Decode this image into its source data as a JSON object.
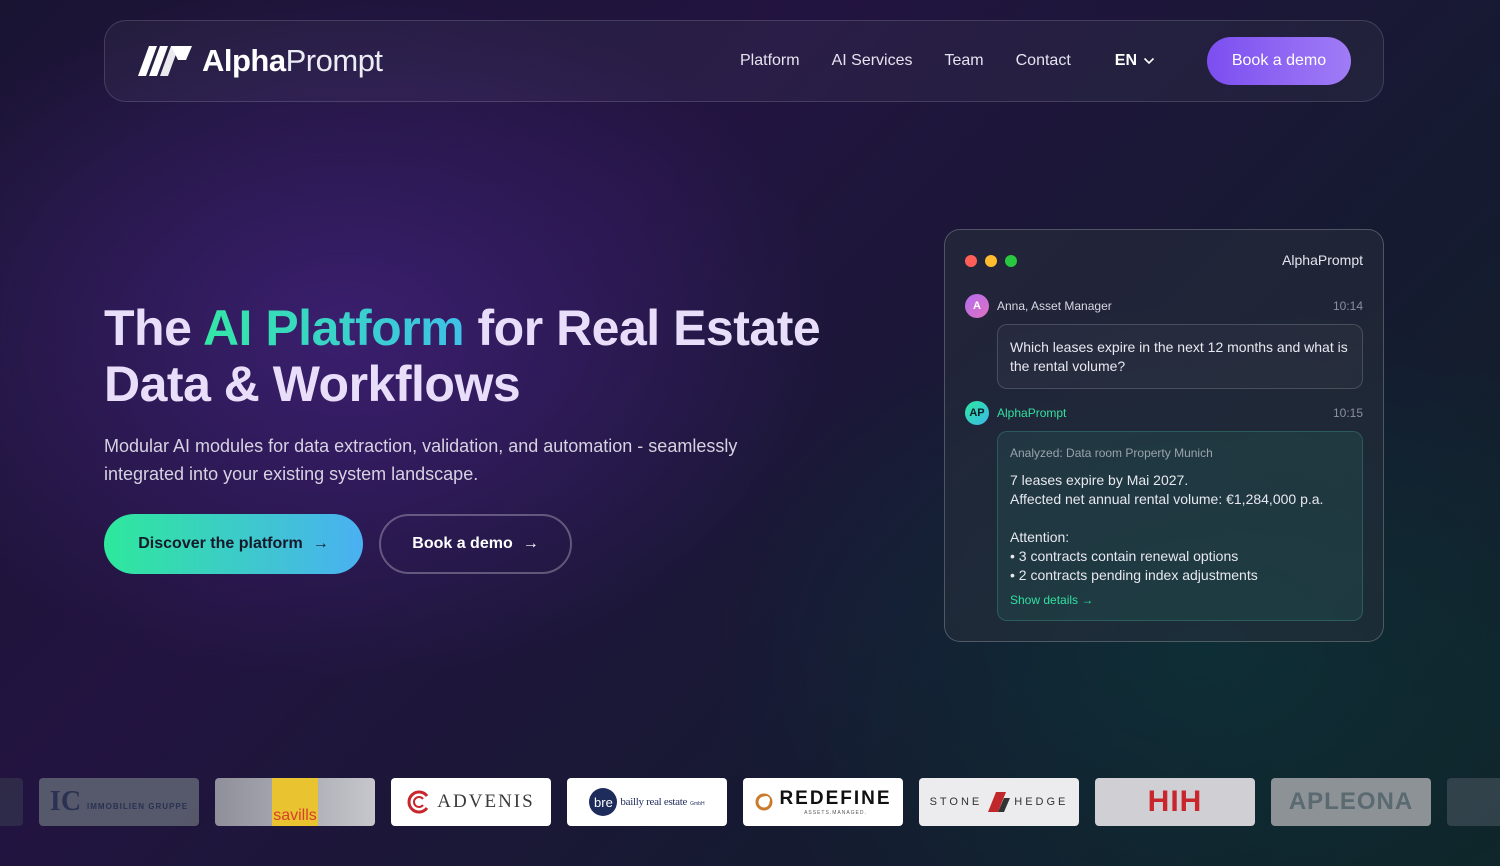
{
  "brand": {
    "name_bold": "Alpha",
    "name_light": "Prompt"
  },
  "nav": {
    "links": [
      "Platform",
      "AI Services",
      "Team",
      "Contact"
    ],
    "language": "EN",
    "cta": "Book a demo"
  },
  "hero": {
    "title_part1": "The ",
    "title_highlight": "AI Platform",
    "title_part2": " for Real Estate Data & Workflows",
    "subtitle": "Modular AI modules for data extraction, validation, and automation - seamlessly integrated into your existing system landscape.",
    "primary_button": "Discover the platform",
    "secondary_button": "Book a demo",
    "arrow": "→"
  },
  "chat": {
    "window_title": "AlphaPrompt",
    "user": {
      "initial": "A",
      "name": "Anna, Asset Manager",
      "time": "10:14",
      "message": "Which leases expire in the next 12 months and what is the rental volume?"
    },
    "assistant": {
      "initials": "AP",
      "name": "AlphaPrompt",
      "time": "10:15",
      "meta": "Analyzed: Data room Property Munich",
      "line1": "7 leases expire by Mai 2027.",
      "line2": "Affected net annual rental volume: €1,284,000 p.a.",
      "line3": "Attention:",
      "line4": "• 3 contracts contain renewal options",
      "line5": "• 2 contracts pending index adjustments",
      "link": "Show details →"
    }
  },
  "clients": {
    "ic_mark": "IC",
    "ic_text": "IMMOBILIEN GRUPPE",
    "savills": "savills",
    "advenis": "ADVENIS",
    "bre_mark": "bre",
    "bre_text": "bailly real estate",
    "bre_suffix": "GmbH",
    "redefine": "REDEFINE",
    "redefine_sub": "ASSETS.MANAGED.",
    "stone": "STONE",
    "hedge": "HEDGE",
    "hih": "HIH",
    "apleona": "APLEONA"
  },
  "colors": {
    "accent_purple": "#7c4ef0",
    "accent_green": "#2ee89c",
    "accent_cyan": "#4ab0f2"
  }
}
